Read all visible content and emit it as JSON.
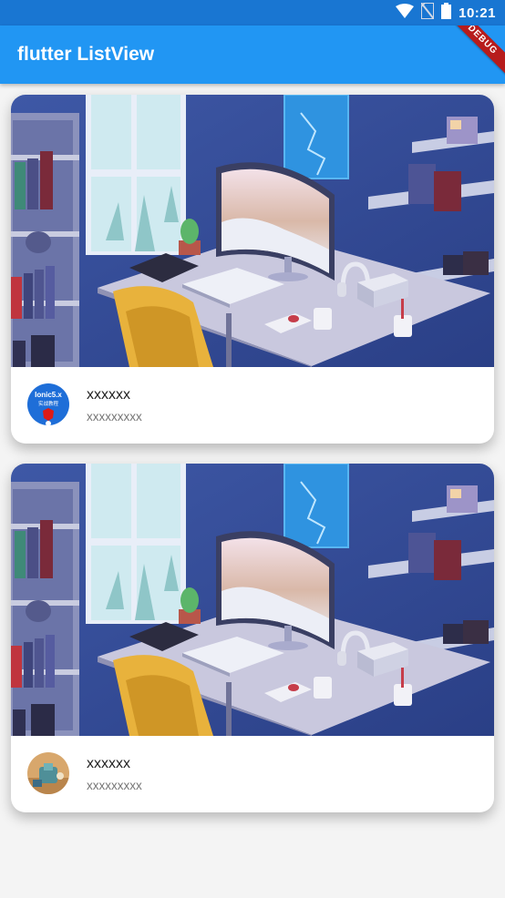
{
  "status_bar": {
    "time": "10:21",
    "icons": [
      "wifi-icon",
      "no-sim-icon",
      "battery-icon"
    ]
  },
  "app_bar": {
    "title": "flutter ListView"
  },
  "debug_banner": {
    "label": "DEBUG"
  },
  "colors": {
    "app_bar": "#2196f3",
    "status_bar": "#1976d2",
    "debug": "#b71c1c"
  },
  "cards": [
    {
      "image": "room-desk-illustration",
      "avatar": {
        "icon": "ionic-course-logo",
        "text_line1": "Ionic5.x",
        "text_line2": "实战教程"
      },
      "title": "xxxxxx",
      "subtitle": "xxxxxxxxx"
    },
    {
      "image": "room-desk-illustration",
      "avatar": {
        "icon": "toy-figure-photo"
      },
      "title": "xxxxxx",
      "subtitle": "xxxxxxxxx"
    }
  ]
}
